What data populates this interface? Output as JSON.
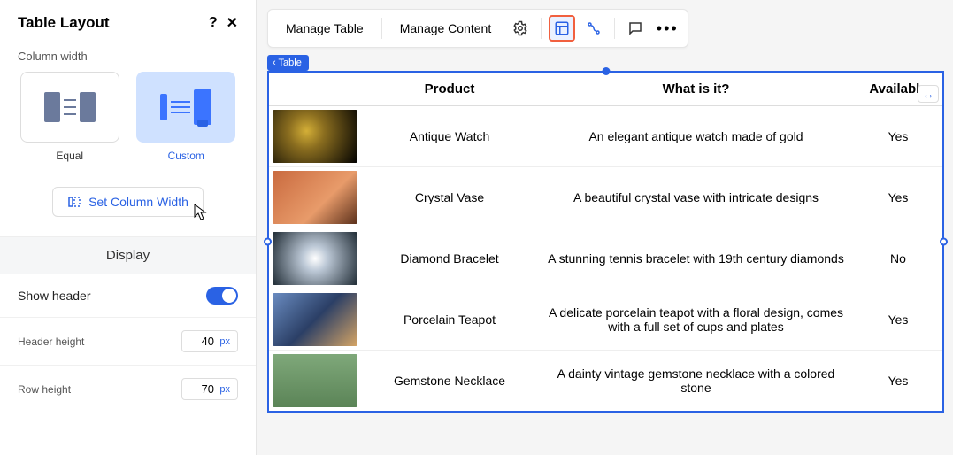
{
  "sidebar": {
    "title": "Table Layout",
    "column_width_label": "Column width",
    "options": {
      "equal": "Equal",
      "custom": "Custom"
    },
    "set_width_label": "Set Column Width",
    "display_header": "Display",
    "show_header_label": "Show header",
    "header_height_label": "Header height",
    "header_height_value": "40",
    "row_height_label": "Row height",
    "row_height_value": "70",
    "unit": "px"
  },
  "toolbar": {
    "manage_table": "Manage Table",
    "manage_content": "Manage Content"
  },
  "breadcrumb": "Table",
  "columns": {
    "product": "Product",
    "what": "What is it?",
    "available": "Available"
  },
  "rows": [
    {
      "product": "Antique Watch",
      "what": "An elegant antique watch made of gold",
      "available": "Yes",
      "thumb": "watch"
    },
    {
      "product": "Crystal Vase",
      "what": "A beautiful crystal vase with intricate designs",
      "available": "Yes",
      "thumb": "vase"
    },
    {
      "product": "Diamond Bracelet",
      "what": "A stunning tennis bracelet with 19th century diamonds",
      "available": "No",
      "thumb": "bracelet"
    },
    {
      "product": "Porcelain Teapot",
      "what": "A delicate porcelain teapot with a floral design, comes with a full set of cups and plates",
      "available": "Yes",
      "thumb": "teapot"
    },
    {
      "product": "Gemstone Necklace",
      "what": "A dainty vintage gemstone necklace with a colored stone",
      "available": "Yes",
      "thumb": "necklace"
    }
  ]
}
